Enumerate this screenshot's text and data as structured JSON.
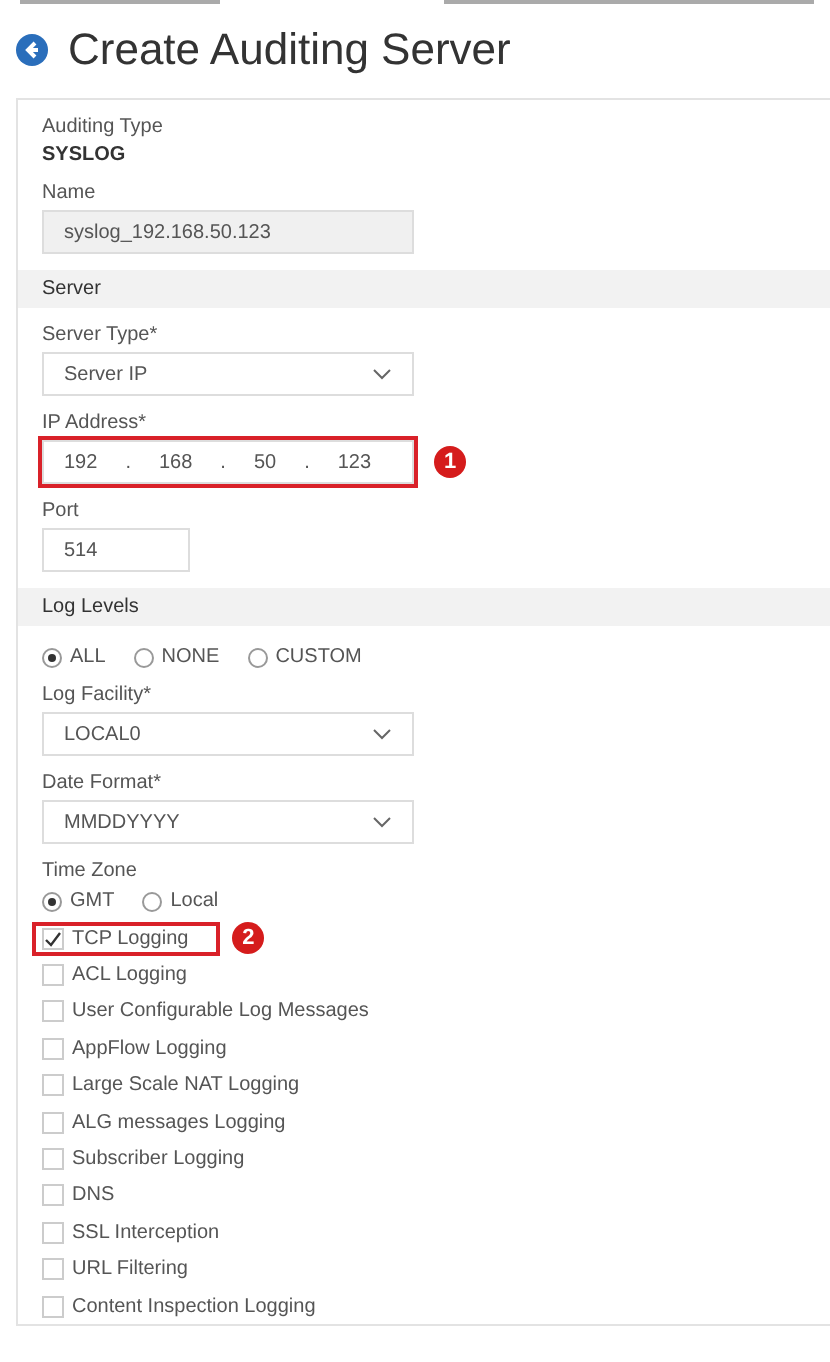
{
  "page": {
    "title": "Create Auditing Server"
  },
  "form": [
    {
      "kind": "static",
      "label": "Auditing Type",
      "value": "SYSLOG"
    },
    {
      "kind": "text",
      "label": "Name",
      "value": "syslog_192.168.50.123",
      "disabled": true
    },
    {
      "kind": "section",
      "title": "Server"
    },
    {
      "kind": "select",
      "label": "Server Type*",
      "value": "Server IP"
    },
    {
      "kind": "ip",
      "label": "IP Address*",
      "octets": [
        "192",
        "168",
        "50",
        "123"
      ],
      "separator": ".",
      "callout": "1"
    },
    {
      "kind": "text",
      "label": "Port",
      "value": "514",
      "disabled": false
    },
    {
      "kind": "section",
      "title": "Log Levels"
    },
    {
      "kind": "radios",
      "options": [
        {
          "label": "ALL",
          "selected": true
        },
        {
          "label": "NONE",
          "selected": false
        },
        {
          "label": "CUSTOM",
          "selected": false
        }
      ]
    },
    {
      "kind": "select",
      "label": "Log Facility*",
      "value": "LOCAL0"
    },
    {
      "kind": "select",
      "label": "Date Format*",
      "value": "MMDDYYYY"
    },
    {
      "kind": "radios",
      "label": "Time Zone",
      "options": [
        {
          "label": "GMT",
          "selected": true
        },
        {
          "label": "Local",
          "selected": false
        }
      ]
    },
    {
      "kind": "checks",
      "items": [
        {
          "label": "TCP Logging",
          "checked": true,
          "callout": "2"
        },
        {
          "label": "ACL Logging",
          "checked": false
        },
        {
          "label": "User Configurable Log Messages",
          "checked": false
        },
        {
          "label": "AppFlow Logging",
          "checked": false
        },
        {
          "label": "Large Scale NAT Logging",
          "checked": false
        },
        {
          "label": "ALG messages Logging",
          "checked": false
        },
        {
          "label": "Subscriber Logging",
          "checked": false
        },
        {
          "label": "DNS",
          "checked": false
        },
        {
          "label": "SSL Interception",
          "checked": false
        },
        {
          "label": "URL Filtering",
          "checked": false
        },
        {
          "label": "Content Inspection Logging",
          "checked": false
        }
      ]
    }
  ]
}
